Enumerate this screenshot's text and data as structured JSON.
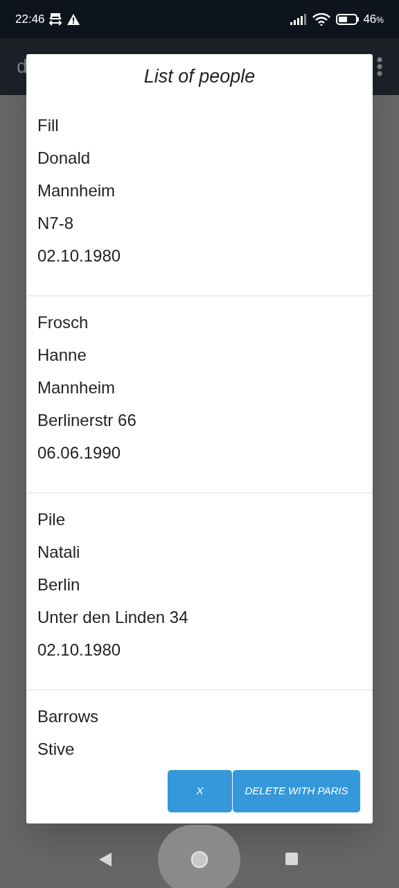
{
  "status_bar": {
    "time": "22:46",
    "battery": "46",
    "battery_unit": "%"
  },
  "app_bar": {
    "title": "d"
  },
  "dialog": {
    "title": "List of people",
    "people": [
      {
        "lines": [
          "Fill",
          "Donald",
          "Mannheim",
          "N7-8",
          "02.10.1980"
        ]
      },
      {
        "lines": [
          "Frosch",
          "Hanne",
          "Mannheim",
          "Berlinerstr 66",
          "06.06.1990"
        ]
      },
      {
        "lines": [
          "Pile",
          "Natali",
          "Berlin",
          "Unter den Linden 34",
          "02.10.1980"
        ]
      },
      {
        "lines": [
          "Barrows",
          "Stive"
        ]
      }
    ],
    "buttons": [
      "X",
      "DELETE WITH PARIS"
    ]
  }
}
